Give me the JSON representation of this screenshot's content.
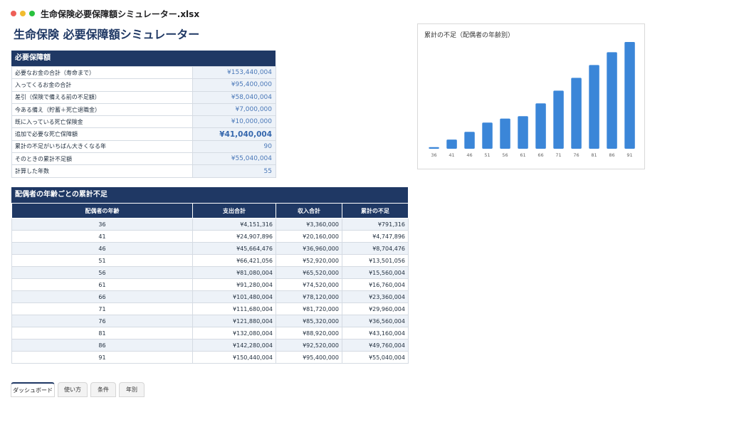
{
  "window": {
    "title": "生命保険必要保障額シミュレーター.xlsx"
  },
  "page": {
    "title": "生命保険 必要保障額シミュレーター"
  },
  "summary": {
    "header": "必要保障額",
    "rows": [
      {
        "label": "必要なお金の合計（寿命まで）",
        "value": "¥153,440,004"
      },
      {
        "label": "入ってくるお金の合計",
        "value": "¥95,400,000"
      },
      {
        "label": "差引（保険で備える前の不足額）",
        "value": "¥58,040,004"
      },
      {
        "label": "今ある備え（貯蓄＋死亡退職金）",
        "value": "¥7,000,000"
      },
      {
        "label": "既に入っている死亡保険金",
        "value": "¥10,000,000"
      },
      {
        "label": "追加で必要な死亡保障額",
        "value": "¥41,040,004"
      },
      {
        "label": "累計の不足がいちばん大きくなる年",
        "value": "90"
      },
      {
        "label": "そのときの累計不足額",
        "value": "¥55,040,004"
      },
      {
        "label": "計算した年数",
        "value": "55"
      }
    ]
  },
  "detail": {
    "header": "配偶者の年齢ごとの累計不足",
    "columns": [
      "配偶者の年齢",
      "支出合計",
      "収入合計",
      "累計の不足"
    ],
    "rows": [
      [
        "36",
        "¥4,151,316",
        "¥3,360,000",
        "¥791,316"
      ],
      [
        "41",
        "¥24,907,896",
        "¥20,160,000",
        "¥4,747,896"
      ],
      [
        "46",
        "¥45,664,476",
        "¥36,960,000",
        "¥8,704,476"
      ],
      [
        "51",
        "¥66,421,056",
        "¥52,920,000",
        "¥13,501,056"
      ],
      [
        "56",
        "¥81,080,004",
        "¥65,520,000",
        "¥15,560,004"
      ],
      [
        "61",
        "¥91,280,004",
        "¥74,520,000",
        "¥16,760,004"
      ],
      [
        "66",
        "¥101,480,004",
        "¥78,120,000",
        "¥23,360,004"
      ],
      [
        "71",
        "¥111,680,004",
        "¥81,720,000",
        "¥29,960,004"
      ],
      [
        "76",
        "¥121,880,004",
        "¥85,320,000",
        "¥36,560,004"
      ],
      [
        "81",
        "¥132,080,004",
        "¥88,920,000",
        "¥43,160,004"
      ],
      [
        "86",
        "¥142,280,004",
        "¥92,520,000",
        "¥49,760,004"
      ],
      [
        "91",
        "¥150,440,004",
        "¥95,400,000",
        "¥55,040,004"
      ]
    ]
  },
  "chart_data": {
    "type": "bar",
    "title": "累計の不足（配偶者の年齢別）",
    "categories": [
      "36",
      "41",
      "46",
      "51",
      "56",
      "61",
      "66",
      "71",
      "76",
      "81",
      "86",
      "91"
    ],
    "values": [
      791316,
      4747896,
      8704476,
      13501056,
      15560004,
      16760004,
      23360004,
      29960004,
      36560004,
      43160004,
      49760004,
      55040004
    ],
    "color": "#3b86d8",
    "grid": false,
    "legend": "none",
    "ylim": [
      0,
      55040004
    ]
  },
  "tabs": [
    {
      "label": "ダッシュボード",
      "active": true
    },
    {
      "label": "使い方",
      "active": false
    },
    {
      "label": "条件",
      "active": false
    },
    {
      "label": "年別",
      "active": false
    }
  ]
}
